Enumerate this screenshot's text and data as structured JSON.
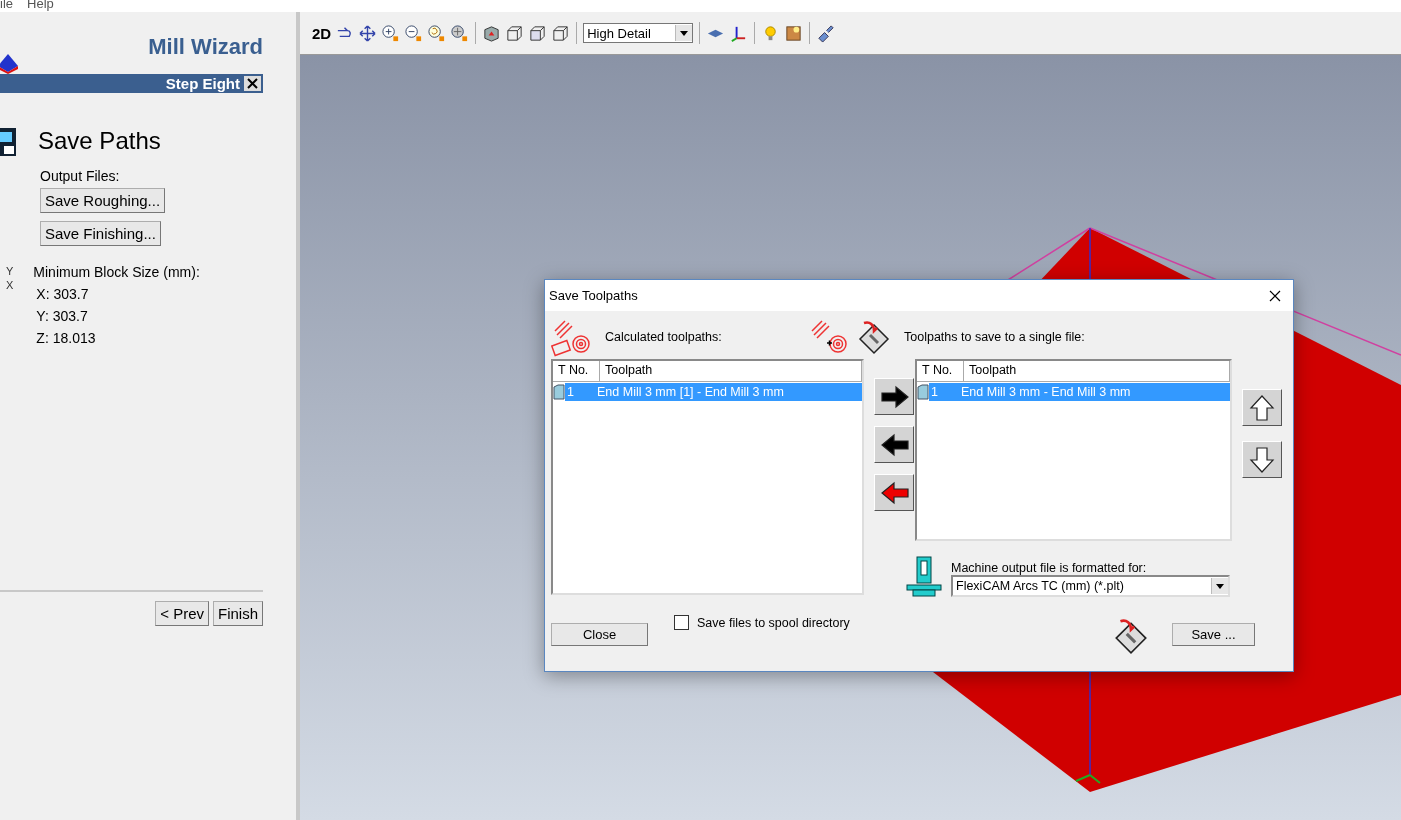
{
  "menu": [
    {
      "label": "ile"
    },
    {
      "label": "Help"
    }
  ],
  "wizard": {
    "title": "Mill Wizard",
    "step": "Step Eight",
    "heading": "Save Paths",
    "output_label": "Output Files:",
    "output_buttons": [
      "Save Roughing...",
      "Save Finishing..."
    ],
    "axis_labels": [
      "Y",
      "X"
    ],
    "block_label": "Minimum Block Size (mm):",
    "block_values": [
      "X: 303.7",
      "Y: 303.7",
      "Z: 18.013"
    ],
    "nav_buttons": [
      "< Prev",
      "Finish"
    ]
  },
  "toolbar": {
    "mode_label": "2D",
    "detail": "High Detail"
  },
  "dialog": {
    "title": "Save Toolpaths",
    "left_label": "Calculated toolpaths:",
    "right_label": "Toolpaths to save to a single file:",
    "left_list": {
      "columns": [
        "T No.",
        "Toolpath"
      ],
      "rows": [
        {
          "number": "1",
          "name": "End Mill 3 mm [1] - End Mill 3 mm",
          "selected": true
        }
      ]
    },
    "right_list": {
      "columns": [
        "T No.",
        "Toolpath"
      ],
      "rows": [
        {
          "number": "1",
          "name": "End Mill 3 mm - End Mill 3 mm",
          "selected": true
        }
      ]
    },
    "machine_label": "Machine output file is formatted for:",
    "machine_format": "FlexiCAM Arcs TC (mm) (*.plt)",
    "spool": {
      "label": "Save files to spool directory",
      "checked": false
    },
    "close_button": "Close",
    "save_button": "Save ..."
  }
}
